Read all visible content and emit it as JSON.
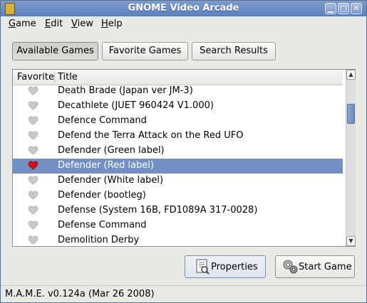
{
  "window": {
    "title": "GNOME Video Arcade",
    "minimize_label": "▁",
    "maximize_label": "□",
    "close_label": "✕"
  },
  "menu": [
    {
      "label": "Game",
      "accel": "G",
      "rest": "ame"
    },
    {
      "label": "Edit",
      "accel": "E",
      "rest": "dit"
    },
    {
      "label": "View",
      "accel": "V",
      "rest": "iew"
    },
    {
      "label": "Help",
      "accel": "H",
      "rest": "elp"
    }
  ],
  "tabs": {
    "available": {
      "label": "Available Games",
      "selected": true
    },
    "favorite": {
      "label": "Favorite Games"
    },
    "search": {
      "label": "Search Results"
    }
  },
  "columns": {
    "favorite": "Favorite",
    "title": "Title"
  },
  "games": [
    {
      "title": "Death Brade (Japan ver JM-3)",
      "favorite": false
    },
    {
      "title": "Decathlete (JUET 960424 V1.000)",
      "favorite": false
    },
    {
      "title": "Defence Command",
      "favorite": false
    },
    {
      "title": "Defend the Terra Attack on the Red UFO",
      "favorite": false
    },
    {
      "title": "Defender (Green label)",
      "favorite": false
    },
    {
      "title": "Defender (Red label)",
      "favorite": true,
      "selected": true
    },
    {
      "title": "Defender (White label)",
      "favorite": false
    },
    {
      "title": "Defender (bootleg)",
      "favorite": false
    },
    {
      "title": "Defense (System 16B, FD1089A 317-0028)",
      "favorite": false
    },
    {
      "title": "Defense Command",
      "favorite": false
    },
    {
      "title": "Demolition Derby",
      "favorite": false
    }
  ],
  "buttons": {
    "properties": {
      "label": "Properties",
      "icon": "properties-icon"
    },
    "start": {
      "label": "Start Game",
      "icon": "gears-icon"
    }
  },
  "status": "M.A.M.E. v0.124a (Mar 26 2008)",
  "colors": {
    "selection": "#7290c4",
    "heart_on": "#d0101a",
    "heart_off": "#c9c9c9",
    "titlebar": "#6b8cc6"
  }
}
